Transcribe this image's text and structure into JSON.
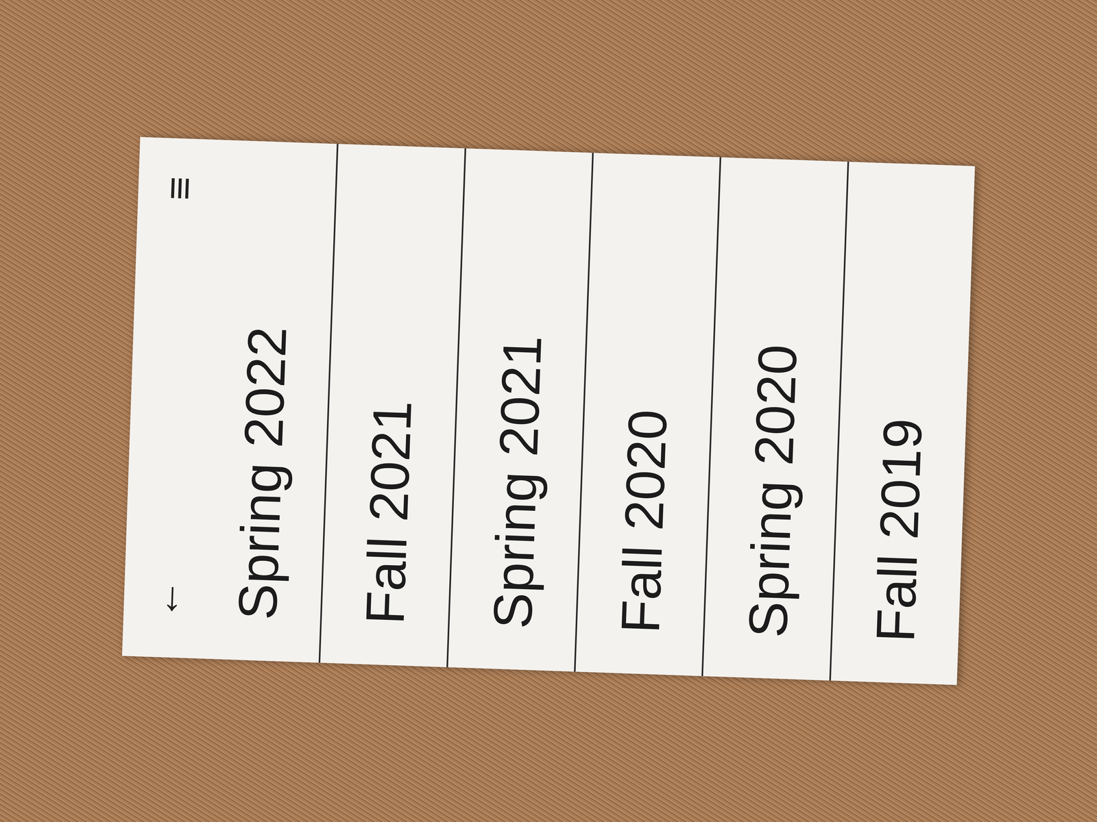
{
  "header": {
    "back": "←",
    "menu": "≡"
  },
  "semesters": [
    {
      "label": "Spring 2022"
    },
    {
      "label": "Fall 2021"
    },
    {
      "label": "Spring 2021"
    },
    {
      "label": "Fall 2020"
    },
    {
      "label": "Spring 2020"
    },
    {
      "label": "Fall 2019"
    }
  ]
}
